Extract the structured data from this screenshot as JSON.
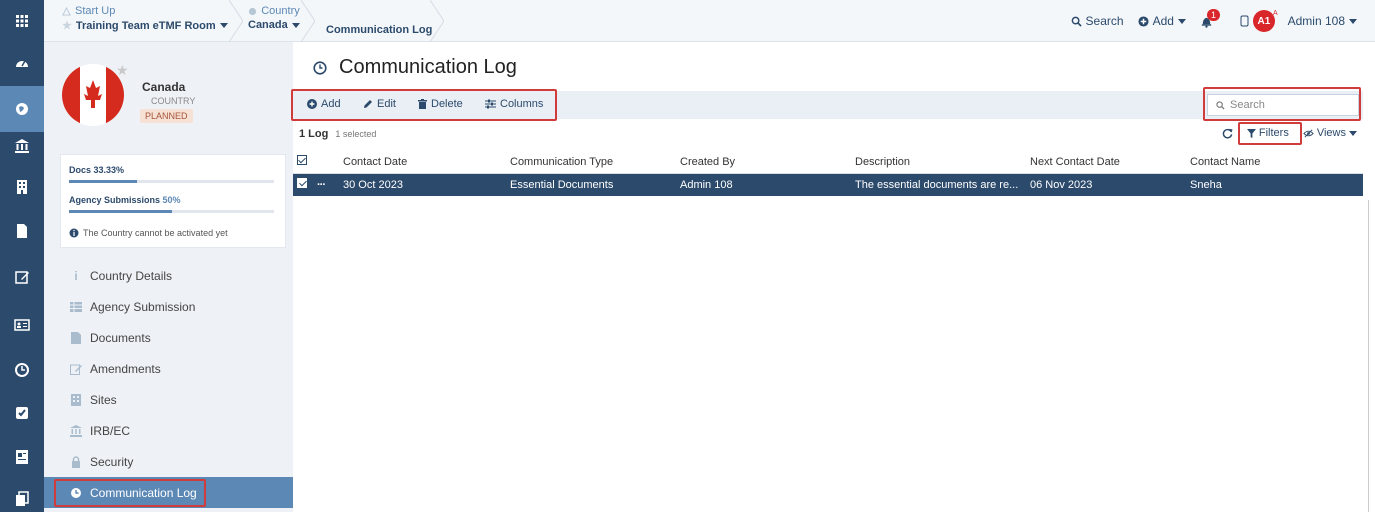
{
  "topbar": {
    "crumb1_small": "Start Up",
    "crumb1_big": "Training Team eTMF Room",
    "crumb2_small": "Country",
    "crumb2_big": "Canada",
    "crumb3": "Communication Log",
    "search_label": "Search",
    "add_label": "Add",
    "notif_count": "1",
    "avatar_initials": "A1",
    "avatar_corner": "A",
    "user_name": "Admin 108"
  },
  "sidebar": {
    "country_name": "Canada",
    "country_type": "COUNTRY",
    "status": "PLANNED",
    "docs_label": "Docs 33.33%",
    "docs_progress": 0.3333,
    "agency_label": "Agency Submissions",
    "agency_pct": "50%",
    "agency_progress": 0.5,
    "warning": "The Country cannot be activated yet",
    "menu": [
      {
        "label": "Country Details",
        "icon": "info-icon"
      },
      {
        "label": "Agency Submission",
        "icon": "table-icon"
      },
      {
        "label": "Documents",
        "icon": "file-icon"
      },
      {
        "label": "Amendments",
        "icon": "edit-icon"
      },
      {
        "label": "Sites",
        "icon": "building-icon"
      },
      {
        "label": "IRB/EC",
        "icon": "bank-icon"
      },
      {
        "label": "Security",
        "icon": "lock-icon"
      },
      {
        "label": "Communication Log",
        "icon": "clock-icon"
      }
    ]
  },
  "main": {
    "title": "Communication Log",
    "toolbar": {
      "add": "Add",
      "edit": "Edit",
      "delete": "Delete",
      "columns": "Columns"
    },
    "search_placeholder": "Search",
    "count": "1 Log",
    "selected": "1 selected",
    "filters": "Filters",
    "views": "Views",
    "columns": [
      "Contact Date",
      "Communication Type",
      "Created By",
      "Description",
      "Next Contact Date",
      "Contact Name"
    ],
    "rows": [
      [
        "30 Oct 2023",
        "Essential Documents",
        "Admin 108",
        "The essential documents are re...",
        "06 Nov 2023",
        "Sneha"
      ]
    ]
  },
  "colors": {
    "navy": "#2c4a6b",
    "accent": "#5c88b5",
    "highlight_red": "#d03c3c"
  }
}
